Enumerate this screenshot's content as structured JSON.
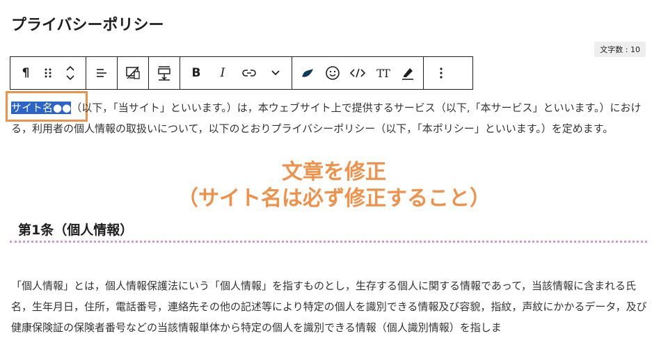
{
  "page": {
    "title": "プライバシーポリシー"
  },
  "word_count": "文字数 : 10",
  "toolbar": {
    "icons": [
      "paragraph-icon",
      "drag-handle-icon",
      "move-up-down-icon",
      "align-icon",
      "display-toggle-icon",
      "spacing-icon",
      "bold-icon",
      "italic-icon",
      "link-icon",
      "more-options-chevron-icon",
      "color-icon",
      "emoji-icon",
      "code-icon",
      "text-size-icon",
      "highlighter-icon",
      "more-menu-icon"
    ],
    "bold": "B",
    "italic": "I",
    "textsize": "TT",
    "paragraph": "¶"
  },
  "intro": {
    "site_name": "サイト名●●",
    "rest": "（以下，「当サイト」といいます。）は，本ウェブサイト上で提供するサービス（以下,「本サービス」といいます。）における，利用者の個人情報の取扱いについて，以下のとおりプライバシーポリシー（以下，「本ポリシー」といいます。）を定めます。"
  },
  "annotation": {
    "line1": "文章を修正",
    "line2": "（サイト名は必ず修正すること）"
  },
  "section": {
    "heading": "第1条（個人情報）",
    "body": "「個人情報」とは，個人情報保護法にいう「個人情報」を指すものとし，生存する個人に関する情報であって，当該情報に含まれる氏名，生年月日，住所，電話番号，連絡先その他の記述等により特定の個人を識別できる情報及び容貌，指紋，声紋にかかるデータ，及び健康保険証の保険者番号などの当該情報単体から特定の個人を識別できる情報（個人識別情報）を指しま"
  },
  "colors": {
    "accent": "#f0914a",
    "selection": "#2b64c8",
    "rule": "#c59ad8"
  }
}
